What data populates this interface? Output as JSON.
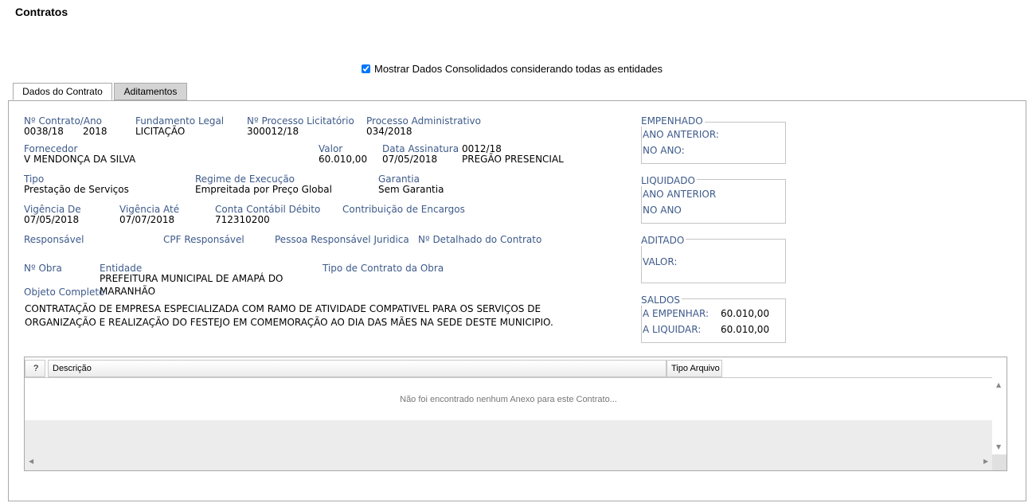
{
  "page": {
    "title": "Contratos"
  },
  "consolidated": {
    "label": "Mostrar Dados Consolidados considerando todas as entidades",
    "checked": true
  },
  "tabs": [
    {
      "label": "Dados do Contrato"
    },
    {
      "label": "Aditamentos"
    }
  ],
  "fields": {
    "contrato_ano": {
      "label": "Nº Contrato/Ano",
      "numero": "0038/18",
      "ano": "2018"
    },
    "fundamento_legal": {
      "label": "Fundamento Legal",
      "value": "LICITAÇÃO"
    },
    "processo_licitatorio": {
      "label": "Nº Processo Licitatório",
      "value": "300012/18"
    },
    "processo_administrativo": {
      "label": "Processo Administrativo",
      "value": "034/2018"
    },
    "fornecedor": {
      "label": "Fornecedor",
      "value": "V MENDONÇA DA SILVA"
    },
    "valor": {
      "label": "Valor",
      "value": "60.010,00"
    },
    "data_assinatura": {
      "label": "Data Assinatura",
      "value": "07/05/2018"
    },
    "modalidade": {
      "numero": "0012/18",
      "nome": "PREGÃO PRESENCIAL"
    },
    "tipo": {
      "label": "Tipo",
      "value": "Prestação de Serviços"
    },
    "regime_execucao": {
      "label": "Regime de Execução",
      "value": "Empreitada por Preço Global"
    },
    "garantia": {
      "label": "Garantia",
      "value": "Sem Garantia"
    },
    "vigencia_de": {
      "label": "Vigência De",
      "value": "07/05/2018"
    },
    "vigencia_ate": {
      "label": "Vigência Até",
      "value": "07/07/2018"
    },
    "conta_contabil": {
      "label": "Conta Contábil Débito",
      "value": "712310200"
    },
    "contribuicao_encargos": {
      "label": "Contribuição de Encargos"
    },
    "responsavel": {
      "label": "Responsável"
    },
    "cpf_responsavel": {
      "label": "CPF Responsável"
    },
    "pessoa_juridica": {
      "label": "Pessoa Responsável Juridica"
    },
    "detalhado_contrato": {
      "label": "Nº Detalhado do Contrato"
    },
    "obra": {
      "label": "Nº Obra"
    },
    "entidade": {
      "label": "Entidade",
      "value_line1": "PREFEITURA MUNICIPAL DE AMAPÁ DO",
      "value_line2": "MARANHÃO"
    },
    "tipo_contrato_obra": {
      "label": "Tipo de Contrato da Obra"
    },
    "objeto_completo": {
      "label": "Objeto Completo",
      "line1": "CONTRATAÇÃO DE EMPRESA ESPECIALIZADA COM RAMO DE ATIVIDADE COMPATIVEL PARA OS SERVIÇOS DE",
      "line2": "ORGANIZAÇÃO E REALIZAÇÃO DO FESTEJO EM COMEMORAÇÃO AO DIA DAS MÃES NA SEDE DESTE MUNICIPIO."
    }
  },
  "summary": {
    "empenhado": {
      "legend": "EMPENHADO",
      "ano_anterior": "ANO ANTERIOR:",
      "no_ano": "NO ANO:"
    },
    "liquidado": {
      "legend": "LIQUIDADO",
      "ano_anterior": "ANO ANTERIOR",
      "no_ano": "NO ANO"
    },
    "aditado": {
      "legend": "ADITADO",
      "valor": "VALOR:"
    },
    "saldos": {
      "legend": "SALDOS",
      "a_empenhar_label": "A EMPENHAR:",
      "a_empenhar_value": "60.010,00",
      "a_liquidar_label": "A LIQUIDAR:",
      "a_liquidar_value": "60.010,00"
    }
  },
  "annex_grid": {
    "columns": [
      {
        "label": "?"
      },
      {
        "label": "Descrição"
      },
      {
        "label": "Tipo Arquivo"
      }
    ],
    "empty_message": "Não foi encontrado nenhum Anexo para este Contrato..."
  }
}
